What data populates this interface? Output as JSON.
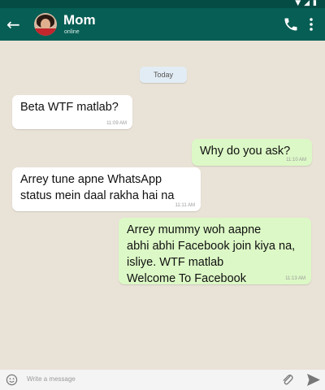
{
  "statusbar": {
    "icons": "▼◢▮"
  },
  "header": {
    "name": "Mom",
    "status": "online"
  },
  "chat": {
    "date_chip": "Today",
    "messages": [
      {
        "direction": "in",
        "lines": [
          "Beta WTF matlab?"
        ],
        "time": "11:09 AM"
      },
      {
        "direction": "out",
        "lines": [
          "Why do you ask?"
        ],
        "time": "11:10 AM"
      },
      {
        "direction": "in",
        "lines": [
          "Arrey tune apne WhatsApp",
          "status mein daal rakha hai na"
        ],
        "time": "11:11 AM"
      },
      {
        "direction": "out",
        "lines": [
          "Arrey mummy woh aapne",
          "abhi abhi Facebook join kiya na,",
          "isliye. WTF matlab",
          "Welcome To Facebook"
        ],
        "time": "11:13 AM"
      }
    ]
  },
  "input": {
    "placeholder": "Write a message"
  },
  "colors": {
    "header": "#075e54",
    "chat_background": "#e9e2d6",
    "outgoing_bubble": "#dcf8c6",
    "incoming_bubble": "#ffffff"
  },
  "icons": {
    "back": "back-arrow-icon",
    "phone": "phone-icon",
    "menu": "more-vertical-icon",
    "emoji": "emoji-icon",
    "attach": "paperclip-icon",
    "send": "send-icon"
  }
}
